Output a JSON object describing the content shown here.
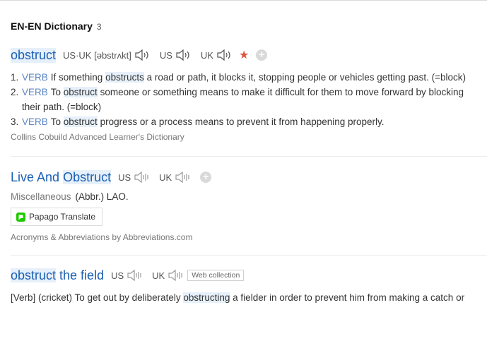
{
  "header": {
    "title": "EN-EN Dictionary",
    "count": "3"
  },
  "entries": {
    "obstruct": {
      "word": "obstruct",
      "pron_usuk_label": "US·UK",
      "pron_ipa": "[əbstrʌkt]",
      "us_label": "US",
      "uk_label": "UK",
      "star_icon": "star-icon",
      "definitions": [
        {
          "num": "1.",
          "pos": "VERB",
          "pre": "If something ",
          "hl": "obstructs",
          "post": " a road or path, it blocks it, stopping people or vehicles getting past. (=block)"
        },
        {
          "num": "2.",
          "pos": "VERB",
          "pre": "To ",
          "hl": "obstruct",
          "post": " someone or something means to make it difficult for them to move forward by blocking their path. (=block)"
        },
        {
          "num": "3.",
          "pos": "VERB",
          "pre": "To ",
          "hl": "obstruct",
          "post": " progress or a process means to prevent it from happening properly."
        }
      ],
      "source": "Collins Cobuild Advanced Learner's Dictionary"
    },
    "live": {
      "word_pre": "Live And ",
      "word_hl": "Obstruct",
      "us_label": "US",
      "uk_label": "UK",
      "misc_label": "Miscellaneous",
      "misc_value": "(Abbr.) LAO.",
      "papago_label": "Papago Translate",
      "source": "Acronyms & Abbreviations by Abbreviations.com"
    },
    "field": {
      "word_hl": "obstruct",
      "word_post": " the field",
      "us_label": "US",
      "uk_label": "UK",
      "badge": "Web collection",
      "text_pre": "[Verb] (cricket) To get out by deliberately ",
      "text_hl": "obstructing",
      "text_post": " a fielder in order to prevent him from making a catch or"
    }
  },
  "colors": {
    "accent": "#1a5fb4",
    "pos": "#5c86c4",
    "star": "#e0553e",
    "highlight": "#e6f0fa"
  }
}
